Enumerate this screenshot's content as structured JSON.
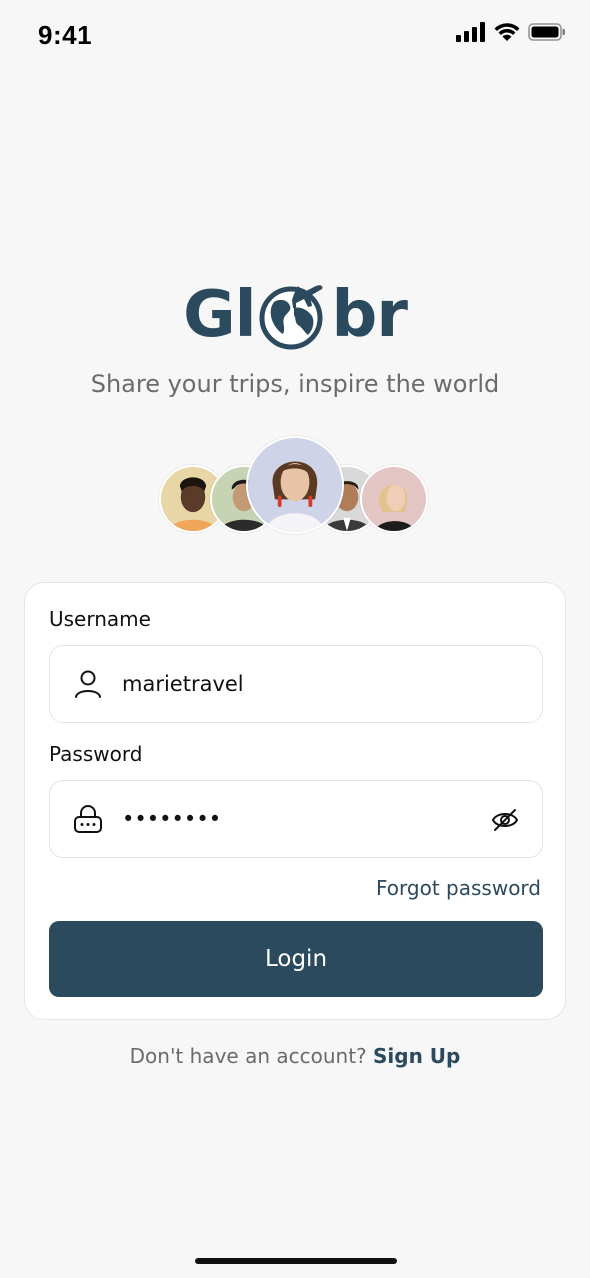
{
  "status_bar": {
    "time": "9:41",
    "icons": [
      "cellular-signal-icon",
      "wifi-icon",
      "battery-icon"
    ]
  },
  "brand": {
    "logo_left": "Gl",
    "logo_right": "br",
    "tagline": "Share your trips, inspire the world",
    "color": "#2c4a5e"
  },
  "avatars": [
    {
      "name": "avatar-1",
      "bg": "#e9d6a6",
      "skin": "#5a3a28"
    },
    {
      "name": "avatar-2",
      "bg": "#c6d4b4",
      "skin": "#c49a74"
    },
    {
      "name": "avatar-main",
      "bg": "#cfd3e8",
      "skin": "#e7c3a8"
    },
    {
      "name": "avatar-4",
      "bg": "#d9d9d9",
      "skin": "#b07d5b"
    },
    {
      "name": "avatar-5",
      "bg": "#e3c6c4",
      "skin": "#f0cdb6"
    }
  ],
  "form": {
    "username_label": "Username",
    "username_value": "marietravel",
    "password_label": "Password",
    "password_value": "••••••••",
    "forgot_label": "Forgot password",
    "login_label": "Login"
  },
  "footer": {
    "prompt": "Don't have an account?",
    "signup_label": "Sign Up"
  },
  "colors": {
    "accent": "#2c4a5e",
    "background": "#f7f7f7"
  }
}
